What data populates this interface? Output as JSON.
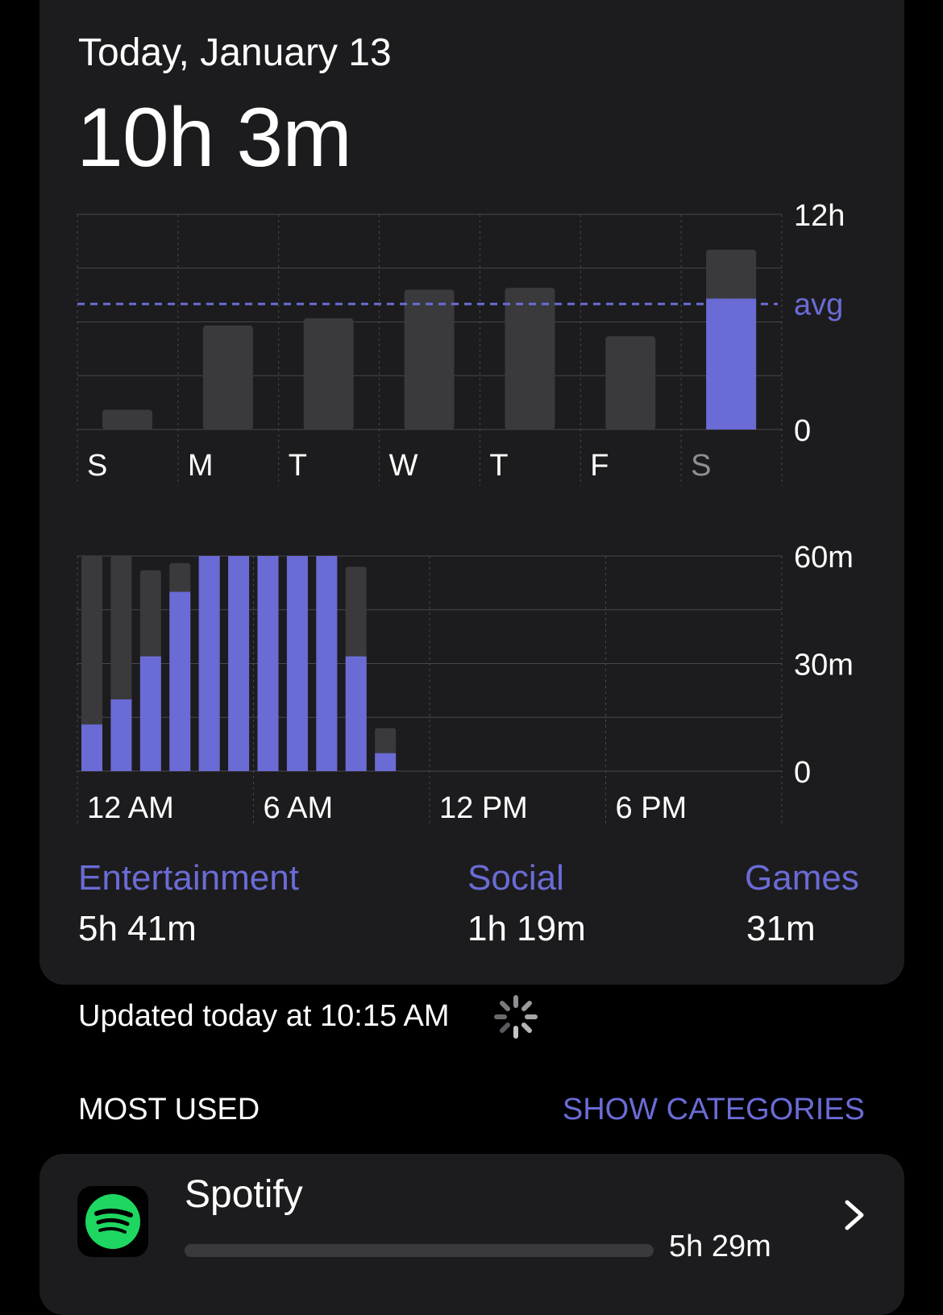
{
  "header": {
    "date": "Today, January 13",
    "total": "10h 3m"
  },
  "colors": {
    "accent": "#6b6bd6",
    "bar_gray": "#3a3a3c",
    "card_bg": "#1c1c1e",
    "spotify_green": "#1ed760"
  },
  "chart_data": [
    {
      "type": "bar",
      "categories": [
        "S",
        "M",
        "T",
        "W",
        "T",
        "F",
        "S"
      ],
      "y_ticks": [
        "12h",
        "0"
      ],
      "avg_label": "avg",
      "avg_hours": 7.0,
      "ylim": [
        0,
        12
      ],
      "series": [
        {
          "values": [
            1.1,
            5.8,
            6.2,
            7.8,
            7.9,
            5.2,
            10.03
          ]
        }
      ],
      "highlight_values": [
        0,
        0,
        0,
        0,
        0,
        0,
        7.3
      ],
      "highlight_index": 6
    },
    {
      "type": "bar",
      "x_tick_labels": [
        "12 AM",
        "6 AM",
        "12 PM",
        "6 PM"
      ],
      "y_ticks": [
        "60m",
        "30m",
        "0"
      ],
      "ylim": [
        0,
        60
      ],
      "series": [
        {
          "values": [
            60,
            60,
            56,
            58,
            60,
            60,
            60,
            60,
            60,
            57,
            12,
            0,
            0,
            0,
            0,
            0,
            0,
            0,
            0,
            0,
            0,
            0,
            0,
            0
          ]
        },
        {
          "values": [
            13,
            20,
            32,
            50,
            60,
            60,
            60,
            60,
            60,
            32,
            5,
            0,
            0,
            0,
            0,
            0,
            0,
            0,
            0,
            0,
            0,
            0,
            0,
            0
          ]
        }
      ]
    }
  ],
  "categories": [
    {
      "label": "Entertainment",
      "value": "5h 41m"
    },
    {
      "label": "Social",
      "value": "1h 19m"
    },
    {
      "label": "Games",
      "value": "31m"
    }
  ],
  "status": {
    "updated": "Updated today at 10:15 AM"
  },
  "most_used": {
    "title": "MOST USED",
    "action": "SHOW CATEGORIES",
    "apps": [
      {
        "name": "Spotify",
        "time": "5h 29m",
        "fraction": 0.97,
        "icon": "spotify-icon"
      }
    ]
  }
}
